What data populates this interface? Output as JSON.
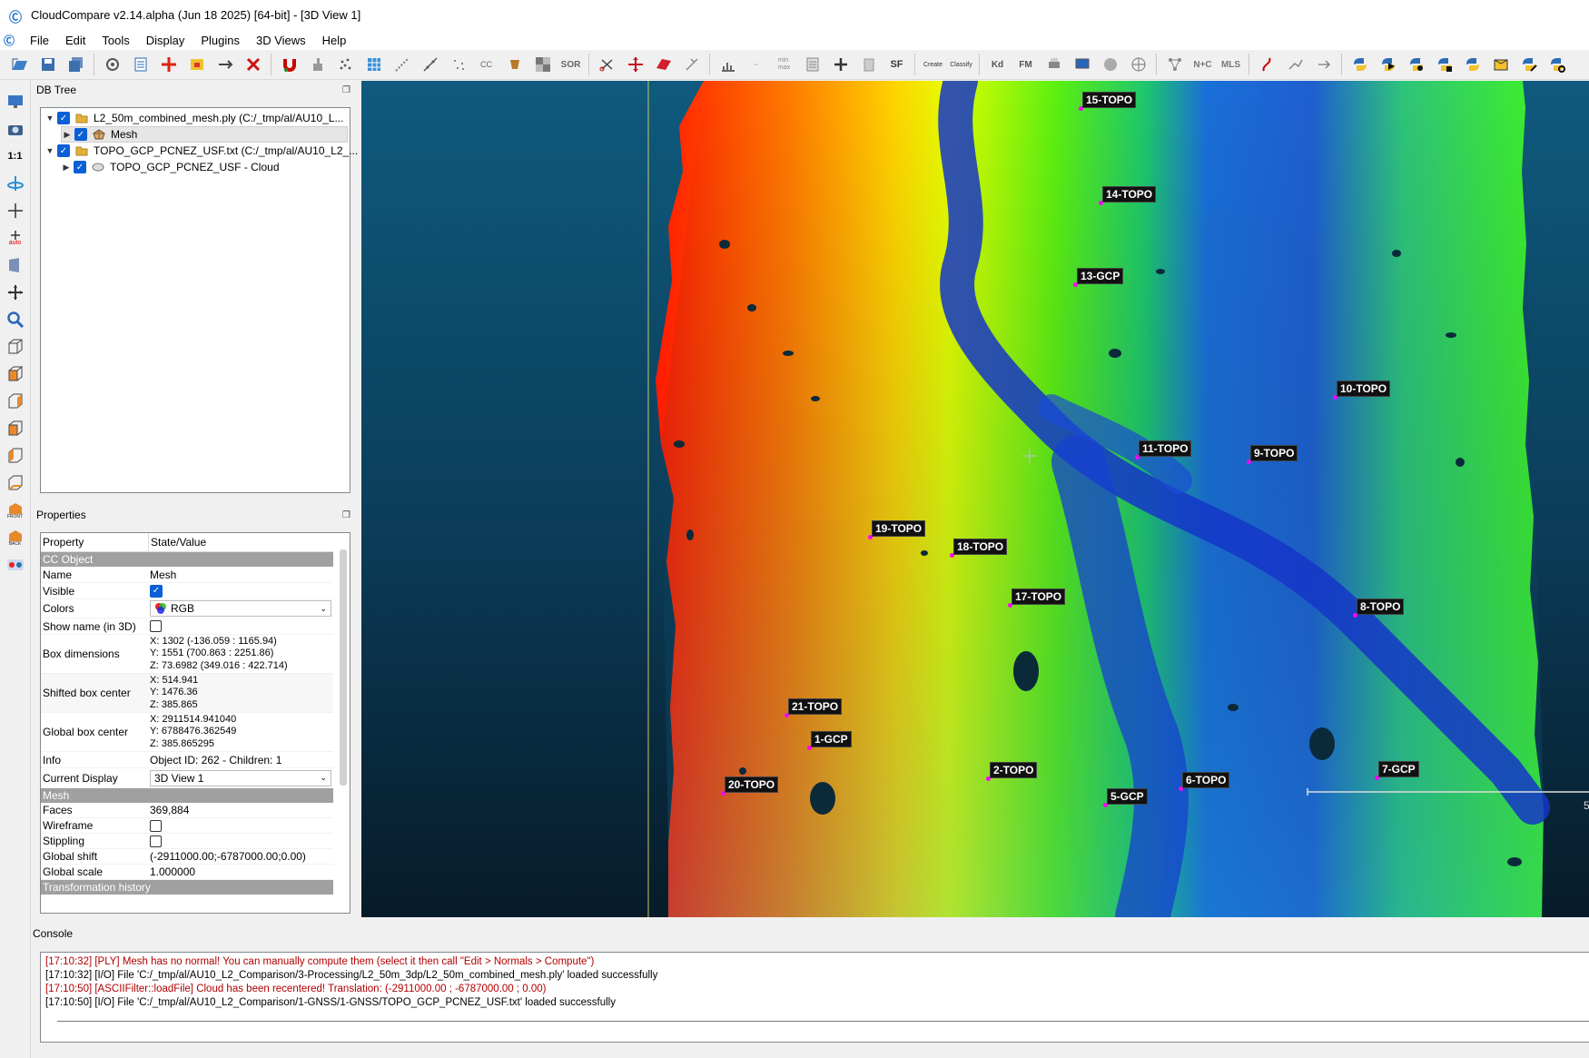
{
  "app": {
    "title": "CloudCompare v2.14.alpha (Jun 18 2025) [64-bit] - [3D View 1]"
  },
  "menu": [
    "File",
    "Edit",
    "Tools",
    "Display",
    "Plugins",
    "3D Views",
    "Help"
  ],
  "toolbar_text": {
    "sor": "SOR",
    "sf": "SF",
    "kd": "Kd",
    "fm": "FM",
    "nc": "N+C",
    "mls": "MLS",
    "cc": "CC",
    "create": "Create",
    "classify": "Classify"
  },
  "left_toolbar": {
    "scale_label": "1:1",
    "auto_label": "auto",
    "front_label": "FRONT",
    "back_label": "BACK"
  },
  "db_tree": {
    "title": "DB Tree",
    "items": [
      {
        "label": "L2_50m_combined_mesh.ply (C:/_tmp/al/AU10_L...",
        "level": 0,
        "type": "file"
      },
      {
        "label": "Mesh",
        "level": 1,
        "type": "mesh"
      },
      {
        "label": "TOPO_GCP_PCNEZ_USF.txt (C:/_tmp/al/AU10_L2_...",
        "level": 0,
        "type": "file"
      },
      {
        "label": "TOPO_GCP_PCNEZ_USF - Cloud",
        "level": 1,
        "type": "cloud"
      }
    ]
  },
  "properties": {
    "title": "Properties",
    "header": {
      "property": "Property",
      "value": "State/Value"
    },
    "section_cc": "CC Object",
    "name_label": "Name",
    "name_value": "Mesh",
    "visible_label": "Visible",
    "colors_label": "Colors",
    "colors_value": "RGB",
    "show_name_label": "Show name (in 3D)",
    "box_dim_label": "Box dimensions",
    "box_dim": [
      "X: 1302 (-136.059 : 1165.94)",
      "Y: 1551 (700.863 : 2251.86)",
      "Z: 73.6982 (349.016 : 422.714)"
    ],
    "shifted_label": "Shifted box center",
    "shifted": [
      "X: 514.941",
      "Y: 1476.36",
      "Z: 385.865"
    ],
    "global_center_label": "Global box center",
    "global_center": [
      "X: 2911514.941040",
      "Y: 6788476.362549",
      "Z: 385.865295"
    ],
    "info_label": "Info",
    "info_value": "Object ID: 262 - Children: 1",
    "current_display_label": "Current Display",
    "current_display_value": "3D View 1",
    "section_mesh": "Mesh",
    "faces_label": "Faces",
    "faces_value": "369,884",
    "wireframe_label": "Wireframe",
    "stippling_label": "Stippling",
    "global_shift_label": "Global shift",
    "global_shift_value": "(-2911000.00;-6787000.00;0.00)",
    "global_scale_label": "Global scale",
    "global_scale_value": "1.000000",
    "section_transform": "Transformation history"
  },
  "viewer": {
    "scale_mark": "5",
    "points": [
      "15-TOPO",
      "14-TOPO",
      "13-GCP",
      "10-TOPO",
      "11-TOPO",
      "9-TOPO",
      "19-TOPO",
      "18-TOPO",
      "17-TOPO",
      "8-TOPO",
      "21-TOPO",
      "1-GCP",
      "2-TOPO",
      "20-TOPO",
      "5-GCP",
      "6-TOPO",
      "7-GCP"
    ],
    "marker_color": "#ff00ff"
  },
  "console": {
    "title": "Console",
    "lines": [
      {
        "text": "[17:10:32] [PLY] Mesh has no normal! You can manually compute them (select it then call \"Edit > Normals > Compute\")",
        "level": "error"
      },
      {
        "text": "[17:10:32] [I/O] File 'C:/_tmp/al/AU10_L2_Comparison/3-Processing/L2_50m_3dp/L2_50m_combined_mesh.ply' loaded successfully",
        "level": "info"
      },
      {
        "text": "[17:10:50] [ASCIIFilter::loadFile] Cloud has been recentered! Translation: (-2911000.00 ; -6787000.00 ; 0.00)",
        "level": "error"
      },
      {
        "text": "[17:10:50] [I/O] File 'C:/_tmp/al/AU10_L2_Comparison/1-GNSS/1-GNSS/TOPO_GCP_PCNEZ_USF.txt' loaded successfully",
        "level": "info"
      }
    ]
  }
}
